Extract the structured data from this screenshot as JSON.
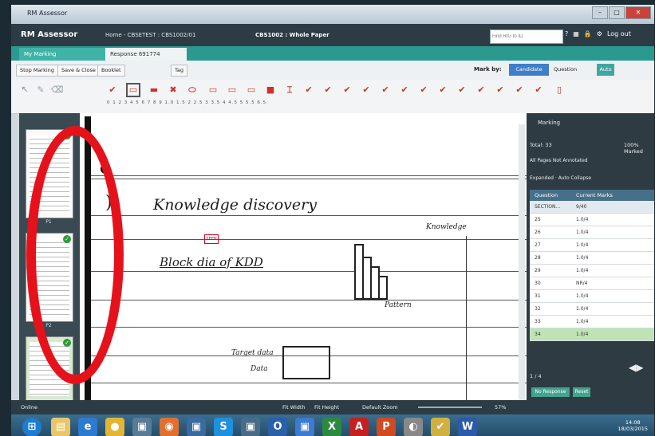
{
  "window": {
    "title": "RM Assessor"
  },
  "header": {
    "logo": "RM Assessor",
    "breadcrumb": "Home - CBSETEST : CBS1002/01",
    "paper": "CBS1002 : Whole Paper",
    "search_placeholder": "Find RIG to ID",
    "logout": "Log out"
  },
  "tabs": [
    {
      "label": "My Marking"
    },
    {
      "label": "Response 691774"
    }
  ],
  "toolbar": {
    "stop": "Stop Marking",
    "save": "Save & Close",
    "booklet": "Booklet",
    "tag": "Tag",
    "mark_by": "Mark by:",
    "candidate": "Candidate",
    "question": "Question",
    "auto": "Auto"
  },
  "ticks": "0 1 2 3 4 5 6 7 8 9 1.0 1.5 2 2.5 3 3.5 4 4.5 5 5.5 6.5",
  "thumbnails": [
    {
      "label": "P1"
    },
    {
      "label": "P2"
    }
  ],
  "script": {
    "line1": "Knowledge discovery",
    "line2": "Block dia of KDD",
    "knowledge": "Knowledge",
    "pattern": "Pattern",
    "data": "Data",
    "target_data": "Target data",
    "stamp": "SEEN"
  },
  "panel": {
    "title": "Marking",
    "total": "Total: 33",
    "marked": "100% Marked",
    "all_pages": "All Pages Not Annotated",
    "expanded": "Expanded",
    "auto_collapse": "Auto Collapse",
    "col_question": "Question",
    "col_marks": "Current Marks",
    "rows": [
      {
        "q": "SECTION...",
        "m": "9/40"
      },
      {
        "q": "25",
        "m": "1.0/4"
      },
      {
        "q": "26",
        "m": "1.0/4"
      },
      {
        "q": "27",
        "m": "1.0/4"
      },
      {
        "q": "28",
        "m": "1.0/4"
      },
      {
        "q": "29",
        "m": "1.0/4"
      },
      {
        "q": "30",
        "m": "NR/4"
      },
      {
        "q": "31",
        "m": "1.0/4"
      },
      {
        "q": "32",
        "m": "1.0/4"
      },
      {
        "q": "33",
        "m": "1.0/4"
      },
      {
        "q": "34",
        "m": "1.0/4"
      }
    ],
    "page": "1 / 4",
    "no_response": "No Response",
    "reset": "Reset"
  },
  "statusbar": {
    "online": "Online",
    "fit_width": "Fit Width",
    "fit_height": "Fit Height",
    "zoom": "Default Zoom",
    "zoom_pct": "57%"
  },
  "taskbar": {
    "time": "14:08",
    "date": "18/03/2015"
  }
}
